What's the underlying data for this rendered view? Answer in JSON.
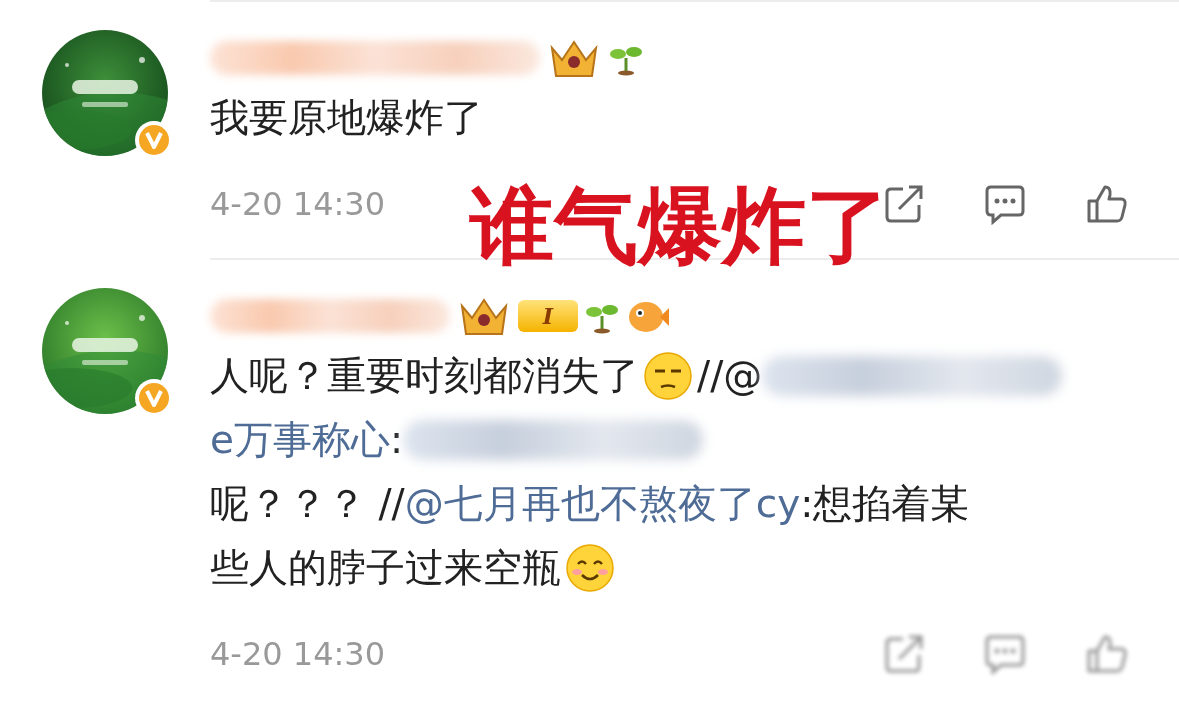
{
  "comments": [
    {
      "verified": true,
      "badges": [
        {
          "kind": "crown"
        },
        {
          "kind": "sprout"
        }
      ],
      "lines": [
        [
          {
            "kind": "text",
            "text": "我要原地爆炸了"
          }
        ]
      ],
      "time": "4-20 14:30",
      "actions_blurred": false
    },
    {
      "verified": true,
      "badges": [
        {
          "kind": "crown"
        },
        {
          "kind": "level",
          "text": "I"
        },
        {
          "kind": "sprout"
        },
        {
          "kind": "fish"
        }
      ],
      "lines": [
        [
          {
            "kind": "text",
            "text": "人呢？重要时刻都消失了"
          },
          {
            "kind": "thinking_emoji"
          },
          {
            "kind": "text",
            "text": "//@"
          },
          {
            "kind": "redacted"
          }
        ],
        [
          {
            "kind": "mention",
            "text": "e万事称心"
          },
          {
            "kind": "text",
            "text": ":"
          },
          {
            "kind": "redacted"
          }
        ],
        [
          {
            "kind": "text",
            "text": "呢？？？ //"
          },
          {
            "kind": "mention",
            "text": "@七月再也不熬夜了cy"
          },
          {
            "kind": "text",
            "text": ":想掐着某"
          }
        ],
        [
          {
            "kind": "text",
            "text": "些人的脖子过来空瓶"
          },
          {
            "kind": "smile_emoji"
          }
        ]
      ],
      "time": "4-20 14:30",
      "actions_blurred": true
    }
  ],
  "overlay": {
    "text": "谁气爆炸了"
  }
}
